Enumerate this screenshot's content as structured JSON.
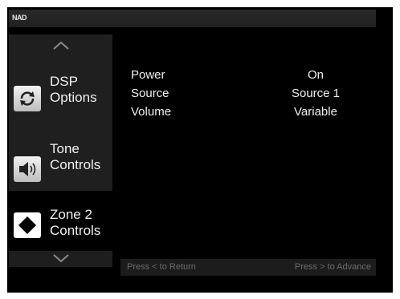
{
  "header": {
    "brand": "NAD"
  },
  "menu": {
    "items": [
      {
        "label": "DSP\nOptions",
        "icon": "refresh-icon"
      },
      {
        "label": "Tone\nControls",
        "icon": "speaker-icon"
      },
      {
        "label": "Zone 2\nControls",
        "icon": "diamond-icon"
      }
    ],
    "scroll_up_icon": "chevron-up-icon",
    "scroll_down_icon": "chevron-down-icon"
  },
  "settings": [
    {
      "name": "Power",
      "value": "On"
    },
    {
      "name": "Source",
      "value": "Source 1"
    },
    {
      "name": "Volume",
      "value": "Variable"
    }
  ],
  "footer": {
    "left_hint": "Press < to Return",
    "right_hint": "Press > to Advance"
  },
  "colors": {
    "background": "#000000",
    "panel": "#1f1f1f",
    "text": "#f0f0f0",
    "hint_text": "#6c6c6c"
  }
}
